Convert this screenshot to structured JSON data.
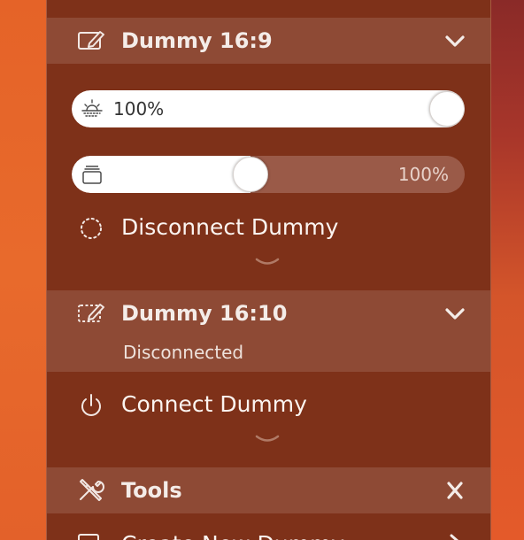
{
  "sections": [
    {
      "title": "Dummy 16:9",
      "icon": "display-pencil-icon",
      "brightness": {
        "icon": "sun-dim-icon",
        "value_text": "100%",
        "level": 1.0
      },
      "second_slider": {
        "icon": "stack-icon",
        "value_text": "100%",
        "level": 0.45
      },
      "action": {
        "icon": "dotted-circle-icon",
        "label": "Disconnect Dummy"
      },
      "toggle_icon": "chevron-down-icon"
    },
    {
      "title": "Dummy 16:10",
      "subtitle": "Disconnected",
      "icon": "dashed-display-pencil-icon",
      "action": {
        "icon": "power-icon",
        "label": "Connect Dummy"
      },
      "toggle_icon": "chevron-down-icon"
    },
    {
      "title": "Tools",
      "icon": "tools-icon",
      "toggle_icon": "close-x-icon",
      "partial_item": "Create New Dummy"
    }
  ],
  "colors": {
    "panel": "#7e3119",
    "header": "#8e4a35",
    "text": "#ffffff"
  }
}
